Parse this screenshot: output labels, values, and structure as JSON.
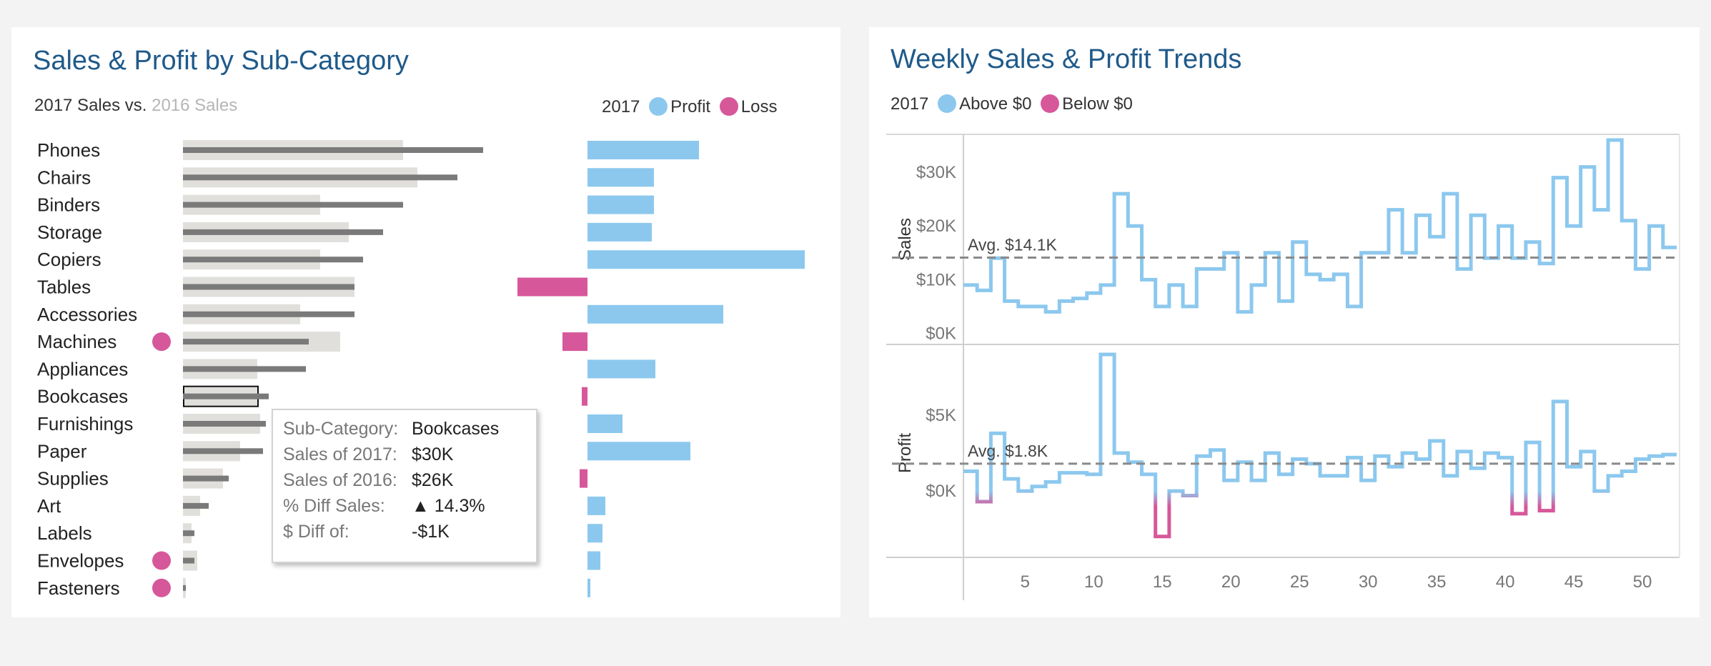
{
  "colors": {
    "title": "#1f5a8a",
    "profit": "#8cc8ee",
    "loss": "#d6589a",
    "sales2016": "#e1dfdc",
    "sales2017": "#7a7a7a",
    "avg": "#8a8a8a"
  },
  "left": {
    "title": "Sales & Profit by Sub-Category",
    "subtitle_a": "2017 Sales vs.",
    "subtitle_b": "2016 Sales",
    "legend_year": "2017",
    "legend_profit": "Profit",
    "legend_loss": "Loss"
  },
  "tooltip": {
    "rows": [
      {
        "k": "Sub-Category:",
        "v": "Bookcases"
      },
      {
        "k": "Sales of 2017:",
        "v": "$30K"
      },
      {
        "k": "Sales of 2016:",
        "v": "$26K"
      },
      {
        "k": "% Diff Sales:",
        "v": "▲ 14.3%"
      },
      {
        "k": "$ Diff of:",
        "v": "-$1K"
      }
    ]
  },
  "right": {
    "title": "Weekly Sales & Profit Trends",
    "legend_year": "2017",
    "legend_above": "Above $0",
    "legend_below": "Below $0"
  },
  "chart_data": [
    {
      "type": "bar",
      "title": "Sales & Profit by Sub-Category",
      "categories": [
        "Phones",
        "Chairs",
        "Binders",
        "Storage",
        "Copiers",
        "Tables",
        "Accessories",
        "Machines",
        "Appliances",
        "Bookcases",
        "Furnishings",
        "Paper",
        "Supplies",
        "Art",
        "Labels",
        "Envelopes",
        "Fasteners"
      ],
      "series": [
        {
          "name": "2016 Sales",
          "values": [
            77,
            82,
            48,
            58,
            48,
            60,
            41,
            55,
            26,
            26,
            27,
            20,
            14,
            6,
            3,
            5,
            1
          ]
        },
        {
          "name": "2017 Sales",
          "values": [
            105,
            96,
            77,
            70,
            63,
            60,
            60,
            44,
            43,
            30,
            29,
            28,
            16,
            9,
            4,
            4,
            1
          ]
        },
        {
          "name": "Profit",
          "values": [
            15.6,
            9.3,
            9.3,
            9.0,
            30.4,
            -9.8,
            19.0,
            -3.5,
            9.5,
            -0.8,
            4.9,
            14.4,
            -1.1,
            2.5,
            2.1,
            1.8,
            0.4
          ]
        }
      ],
      "loss_markers": [
        "Machines",
        "Envelopes",
        "Fasteners"
      ],
      "selected": "Bookcases"
    },
    {
      "type": "line",
      "title": "Weekly Sales & Profit Trends",
      "x": [
        1,
        2,
        3,
        4,
        5,
        6,
        7,
        8,
        9,
        10,
        11,
        12,
        13,
        14,
        15,
        16,
        17,
        18,
        19,
        20,
        21,
        22,
        23,
        24,
        25,
        26,
        27,
        28,
        29,
        30,
        31,
        32,
        33,
        34,
        35,
        36,
        37,
        38,
        39,
        40,
        41,
        42,
        43,
        44,
        45,
        46,
        47,
        48,
        49,
        50,
        51,
        52
      ],
      "xticks": [
        5,
        10,
        15,
        20,
        25,
        30,
        35,
        40,
        45,
        50
      ],
      "series": [
        {
          "name": "Sales",
          "yticks": [
            "$0K",
            "$10K",
            "$20K",
            "$30K"
          ],
          "ylim": [
            -1000,
            36000
          ],
          "avg_label": "Avg. $14.1K",
          "avg": 14100,
          "values": [
            9000,
            8000,
            14000,
            6000,
            5000,
            5000,
            4000,
            6000,
            6500,
            7500,
            9000,
            26000,
            20000,
            10000,
            5000,
            9000,
            5000,
            12000,
            12000,
            15000,
            4000,
            9000,
            15000,
            6000,
            17000,
            11000,
            10000,
            11000,
            5000,
            15000,
            15000,
            23000,
            15000,
            22000,
            18000,
            26000,
            12000,
            22000,
            14000,
            20000,
            14000,
            17000,
            13000,
            29000,
            20000,
            31000,
            23000,
            36000,
            21000,
            12000,
            20000,
            16000
          ]
        },
        {
          "name": "Profit",
          "yticks": [
            "$0K",
            "$5K"
          ],
          "ylim": [
            -4000,
            9000
          ],
          "avg_label": "Avg. $1.8K",
          "avg": 1800,
          "values": [
            1300,
            -700,
            3800,
            800,
            0,
            300,
            600,
            1200,
            1200,
            1100,
            9000,
            2500,
            1900,
            1100,
            -3000,
            0,
            -300,
            2300,
            2700,
            700,
            1900,
            700,
            2500,
            1100,
            2100,
            1800,
            1000,
            1000,
            2200,
            700,
            2300,
            1600,
            2500,
            2100,
            3300,
            1000,
            2600,
            1500,
            2500,
            2200,
            -1500,
            3200,
            -1300,
            5900,
            1600,
            2600,
            0,
            1000,
            1300,
            2100,
            2300,
            2400
          ]
        }
      ]
    }
  ]
}
